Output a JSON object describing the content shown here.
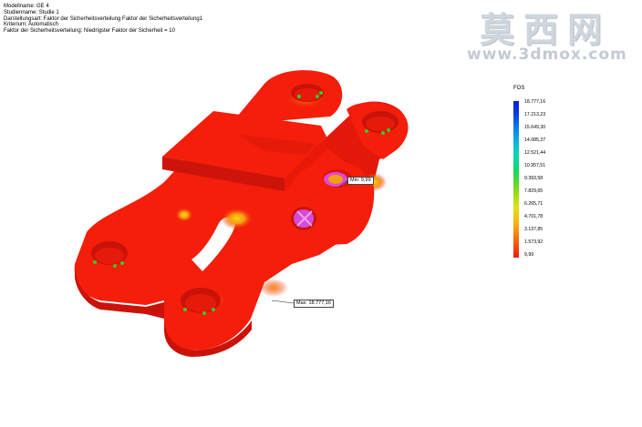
{
  "info": {
    "lines": [
      "Modellname: GE 4",
      "Studienname: Studie 1",
      "Darstellungsart: Faktor der Sicherheitsverteilung Faktor der Sicherheitsverteilung1",
      "Kriterium: Automatisch",
      "Faktor der Sicherheitsverteilung: Niedrigster Faktor der Sicherheit = 10"
    ]
  },
  "watermark": {
    "chinese": "莫西网",
    "url": "www.3dmox.com"
  },
  "legend": {
    "title": "FOS",
    "labels": [
      "18.777,16",
      "17.213,23",
      "15.649,30",
      "14.085,37",
      "12.521,44",
      "10.957,51",
      "9.393,58",
      "7.829,65",
      "6.265,71",
      "4.701,78",
      "3.137,85",
      "1.573,92",
      "9,99"
    ]
  },
  "probes": {
    "min": "Min: 9,99",
    "max": "Max: 18.777,16"
  },
  "colors": {
    "part_red": "#f41e0a",
    "part_dark": "#d8140a",
    "hotspot_orange": "#f37d10",
    "hotspot_yellow": "#f4c00e",
    "bolt_green": "#33cc33",
    "pin_magenta": "#d64ad8"
  }
}
